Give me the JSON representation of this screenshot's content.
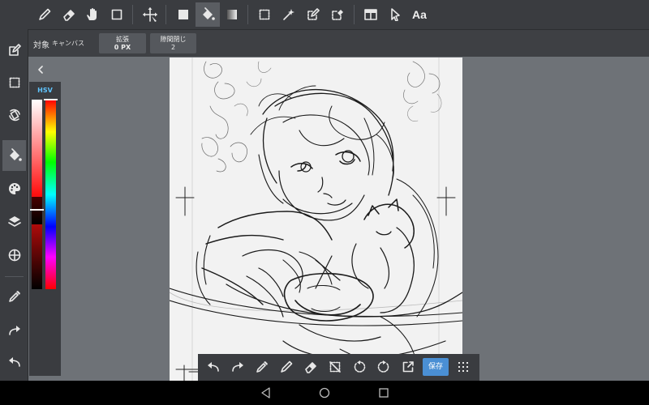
{
  "top_toolbar": {
    "text_tool_label": "Aa",
    "tools": [
      "pen-icon",
      "eraser-icon",
      "hand-icon",
      "rectangle-icon",
      "move-icon",
      "fill-rectangle-icon",
      "bucket-icon",
      "gradient-icon",
      "select-rectangle-icon",
      "magic-wand-icon",
      "select-pen-icon",
      "select-eraser-icon",
      "frame-divide-icon",
      "operation-icon",
      "text-icon"
    ],
    "active_tool": "bucket-icon"
  },
  "options_bar": {
    "target_label": "対象",
    "target_value": "キャンバス",
    "expand_label": "拡張",
    "expand_value": "0 PX",
    "gap_close_label": "隙間閉じ",
    "gap_close_value": "2"
  },
  "sidebar": {
    "items": [
      "menu-icon",
      "edit-icon",
      "selection-icon",
      "rotate-icon",
      "bucket-icon",
      "palette-icon",
      "layers-icon",
      "material-icon",
      "eyedropper-icon",
      "redo-icon",
      "undo-icon"
    ],
    "active_item": "bucket-icon"
  },
  "color_panel": {
    "mode_label": "HSV",
    "current_color": "#000000",
    "hue_marker_fraction": 0.0,
    "value_marker_fraction": 0.58
  },
  "bottom_toolbar": {
    "save_label": "保存",
    "items": [
      "undo-icon",
      "redo-icon",
      "eyedropper-icon",
      "pen-icon",
      "eraser-icon",
      "deselect-icon",
      "rotate-left-icon",
      "rotate-right-icon",
      "export-icon",
      "save-button",
      "grid-menu-icon"
    ]
  },
  "navbar": {
    "items": [
      "back-icon",
      "home-icon",
      "recents-icon"
    ]
  },
  "colors": {
    "toolbar_bg": "#3a3c40",
    "workspace_bg": "#6e7277",
    "canvas_bg": "#f2f2f2",
    "accent": "#4a8fd4",
    "hsv_label": "#5fc4ff"
  }
}
